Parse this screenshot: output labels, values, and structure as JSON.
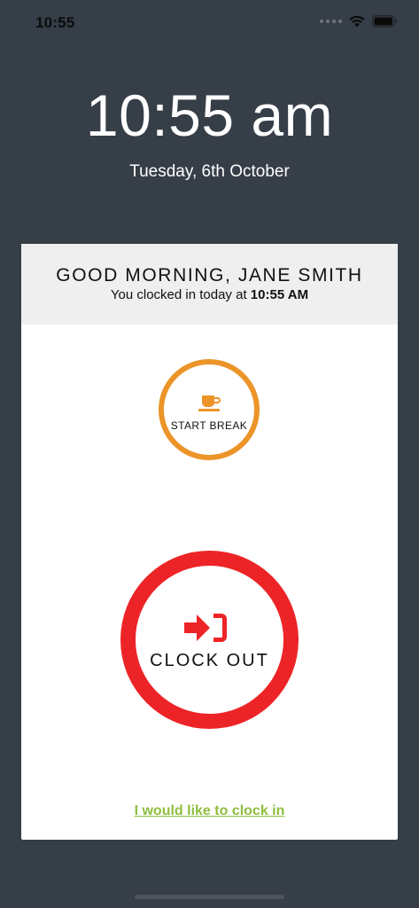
{
  "status_bar": {
    "time": "10:55"
  },
  "clock": {
    "time": "10:55 am",
    "date": "Tuesday, 6th October"
  },
  "card": {
    "greeting": "GOOD MORNING, JANE SMITH",
    "clocked_in_prefix": "You clocked in today at",
    "clocked_in_time": "10:55 AM",
    "break_button_label": "START BREAK",
    "clock_out_label": "CLOCK OUT",
    "clock_in_link": "I would like to clock in"
  },
  "icons": {
    "wifi": "wifi-icon",
    "battery": "battery-icon",
    "signal": "cellular-signal-icon",
    "break": "coffee-cup-icon",
    "clock_out": "sign-out-icon"
  },
  "colors": {
    "background": "#363e48",
    "break_accent": "#ec9428",
    "clock_out_accent": "#ed2427",
    "link": "#8ebf3f",
    "header_bg": "#efefef"
  }
}
